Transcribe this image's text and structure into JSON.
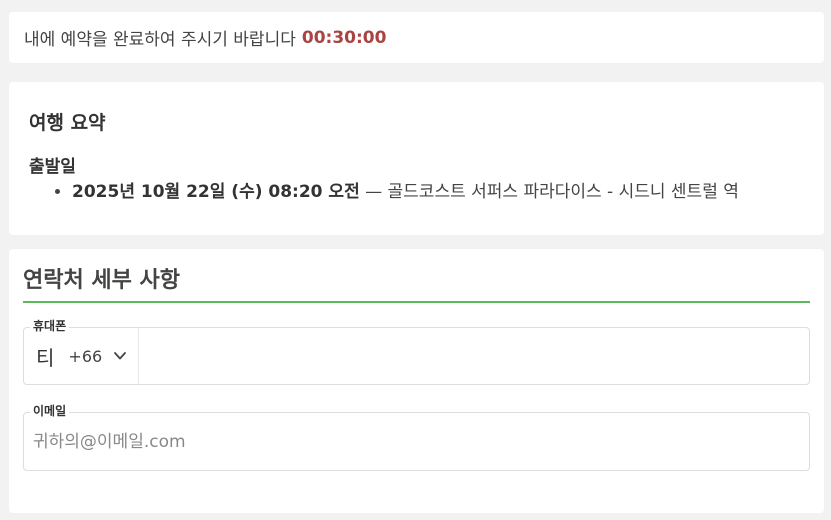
{
  "timer": {
    "message": "내에 예약을 완료하여 주시기 바랍니다",
    "countdown": "00:30:00"
  },
  "trip_summary": {
    "title": "여행 요약",
    "departure_label": "출발일",
    "departures": [
      {
        "datetime": "2025년 10월 22일 (수) 08:20 오전",
        "route": " — 골드코스트 서퍼스 파라다이스 - 시드니 센트럴 역"
      }
    ]
  },
  "contact": {
    "title": "연락처 세부 사항",
    "phone": {
      "label": "휴대폰",
      "country_flag": "티",
      "country_code": "+66",
      "value": "",
      "chevron_icon": "chevron-down-icon"
    },
    "email": {
      "label": "이메일",
      "placeholder": "귀하의@이메일.com",
      "value": ""
    }
  },
  "colors": {
    "countdown": "#a94442",
    "section_underline": "#5cb85c",
    "page_background": "#f2f2f2"
  }
}
